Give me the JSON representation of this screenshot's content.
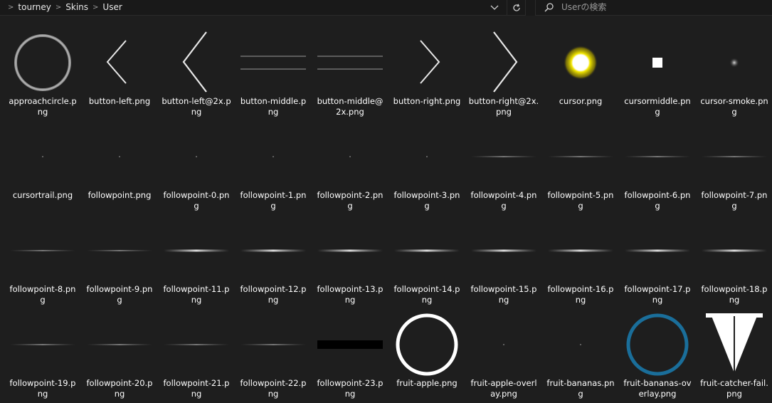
{
  "address_bar": {
    "breadcrumbs": [
      "tourney",
      "Skins",
      "User"
    ]
  },
  "search": {
    "placeholder": "Userの検索"
  },
  "files": [
    {
      "name": "approachcircle.png",
      "label": "approachcircle.p\nng",
      "icon": "ring-thumb"
    },
    {
      "name": "button-left.png",
      "label": "button-left.png",
      "icon": "chevron-left-small-thumb"
    },
    {
      "name": "button-left@2x.png",
      "label": "button-left@2x.p\nng",
      "icon": "chevron-left-large-thumb"
    },
    {
      "name": "button-middle.png",
      "label": "button-middle.p\nng",
      "icon": "bar-thumb"
    },
    {
      "name": "button-middle@2x.png",
      "label": "button-middle@\n2x.png",
      "icon": "bar-thumb"
    },
    {
      "name": "button-right.png",
      "label": "button-right.png",
      "icon": "chevron-right-small-thumb"
    },
    {
      "name": "button-right@2x.png",
      "label": "button-right@2x.\npng",
      "icon": "chevron-right-large-thumb"
    },
    {
      "name": "cursor.png",
      "label": "cursor.png",
      "icon": "glowing-dot-thumb"
    },
    {
      "name": "cursormiddle.png",
      "label": "cursormiddle.pn\ng",
      "icon": "white-square-thumb"
    },
    {
      "name": "cursor-smoke.png",
      "label": "cursor-smoke.pn\ng",
      "icon": "smoke-dot-thumb"
    },
    {
      "name": "cursortrail.png",
      "label": "cursortrail.png",
      "icon": "tiny-dot-thumb"
    },
    {
      "name": "followpoint.png",
      "label": "followpoint.png",
      "icon": "tiny-dot-thumb"
    },
    {
      "name": "followpoint-0.png",
      "label": "followpoint-0.pn\ng",
      "icon": "tiny-dot-thumb"
    },
    {
      "name": "followpoint-1.png",
      "label": "followpoint-1.pn\ng",
      "icon": "tiny-dot-thumb"
    },
    {
      "name": "followpoint-2.png",
      "label": "followpoint-2.pn\ng",
      "icon": "tiny-dot-thumb"
    },
    {
      "name": "followpoint-3.png",
      "label": "followpoint-3.pn\ng",
      "icon": "tiny-dot-thumb"
    },
    {
      "name": "followpoint-4.png",
      "label": "followpoint-4.pn\ng",
      "icon": "faint-line-thumb"
    },
    {
      "name": "followpoint-5.png",
      "label": "followpoint-5.pn\ng",
      "icon": "faint-line-thumb"
    },
    {
      "name": "followpoint-6.png",
      "label": "followpoint-6.pn\ng",
      "icon": "faint-line-thumb"
    },
    {
      "name": "followpoint-7.png",
      "label": "followpoint-7.pn\ng",
      "icon": "faint-line-thumb"
    },
    {
      "name": "followpoint-8.png",
      "label": "followpoint-8.pn\ng",
      "icon": "faint-line-thumb"
    },
    {
      "name": "followpoint-9.png",
      "label": "followpoint-9.pn\ng",
      "icon": "faint-line-thumb"
    },
    {
      "name": "followpoint-11.png",
      "label": "followpoint-11.p\nng",
      "icon": "glow-line-thumb"
    },
    {
      "name": "followpoint-12.png",
      "label": "followpoint-12.p\nng",
      "icon": "glow-line-thumb"
    },
    {
      "name": "followpoint-13.png",
      "label": "followpoint-13.p\nng",
      "icon": "glow-line-thumb"
    },
    {
      "name": "followpoint-14.png",
      "label": "followpoint-14.p\nng",
      "icon": "glow-line-thumb"
    },
    {
      "name": "followpoint-15.png",
      "label": "followpoint-15.p\nng",
      "icon": "glow-line-thumb"
    },
    {
      "name": "followpoint-16.png",
      "label": "followpoint-16.p\nng",
      "icon": "glow-line-thumb"
    },
    {
      "name": "followpoint-17.png",
      "label": "followpoint-17.p\nng",
      "icon": "glow-line-thumb"
    },
    {
      "name": "followpoint-18.png",
      "label": "followpoint-18.p\nng",
      "icon": "glow-line-thumb"
    },
    {
      "name": "followpoint-19.png",
      "label": "followpoint-19.p\nng",
      "icon": "faint-line-thumb"
    },
    {
      "name": "followpoint-20.png",
      "label": "followpoint-20.p\nng",
      "icon": "faint-line-thumb"
    },
    {
      "name": "followpoint-21.png",
      "label": "followpoint-21.p\nng",
      "icon": "faint-line-thumb"
    },
    {
      "name": "followpoint-22.png",
      "label": "followpoint-22.p\nng",
      "icon": "faint-line-thumb"
    },
    {
      "name": "followpoint-23.png",
      "label": "followpoint-23.p\nng",
      "icon": "black-bar-thumb"
    },
    {
      "name": "fruit-apple.png",
      "label": "fruit-apple.png",
      "icon": "white-ring-thumb"
    },
    {
      "name": "fruit-apple-overlay.png",
      "label": "fruit-apple-overl\nay.png",
      "icon": "tiny-dot-thumb"
    },
    {
      "name": "fruit-bananas.png",
      "label": "fruit-bananas.pn\ng",
      "icon": "tiny-dot-thumb"
    },
    {
      "name": "fruit-bananas-overlay.png",
      "label": "fruit-bananas-ov\nerlay.png",
      "icon": "blue-ring-thumb"
    },
    {
      "name": "fruit-catcher-fail.png",
      "label": "fruit-catcher-fail.\npng",
      "icon": "catcher-thumb"
    }
  ],
  "colors": {
    "background": "#1e1e1e",
    "text": "#ffffff",
    "cursor_glow": "#f2e600",
    "bananas_ring": "#1a6e9a"
  }
}
